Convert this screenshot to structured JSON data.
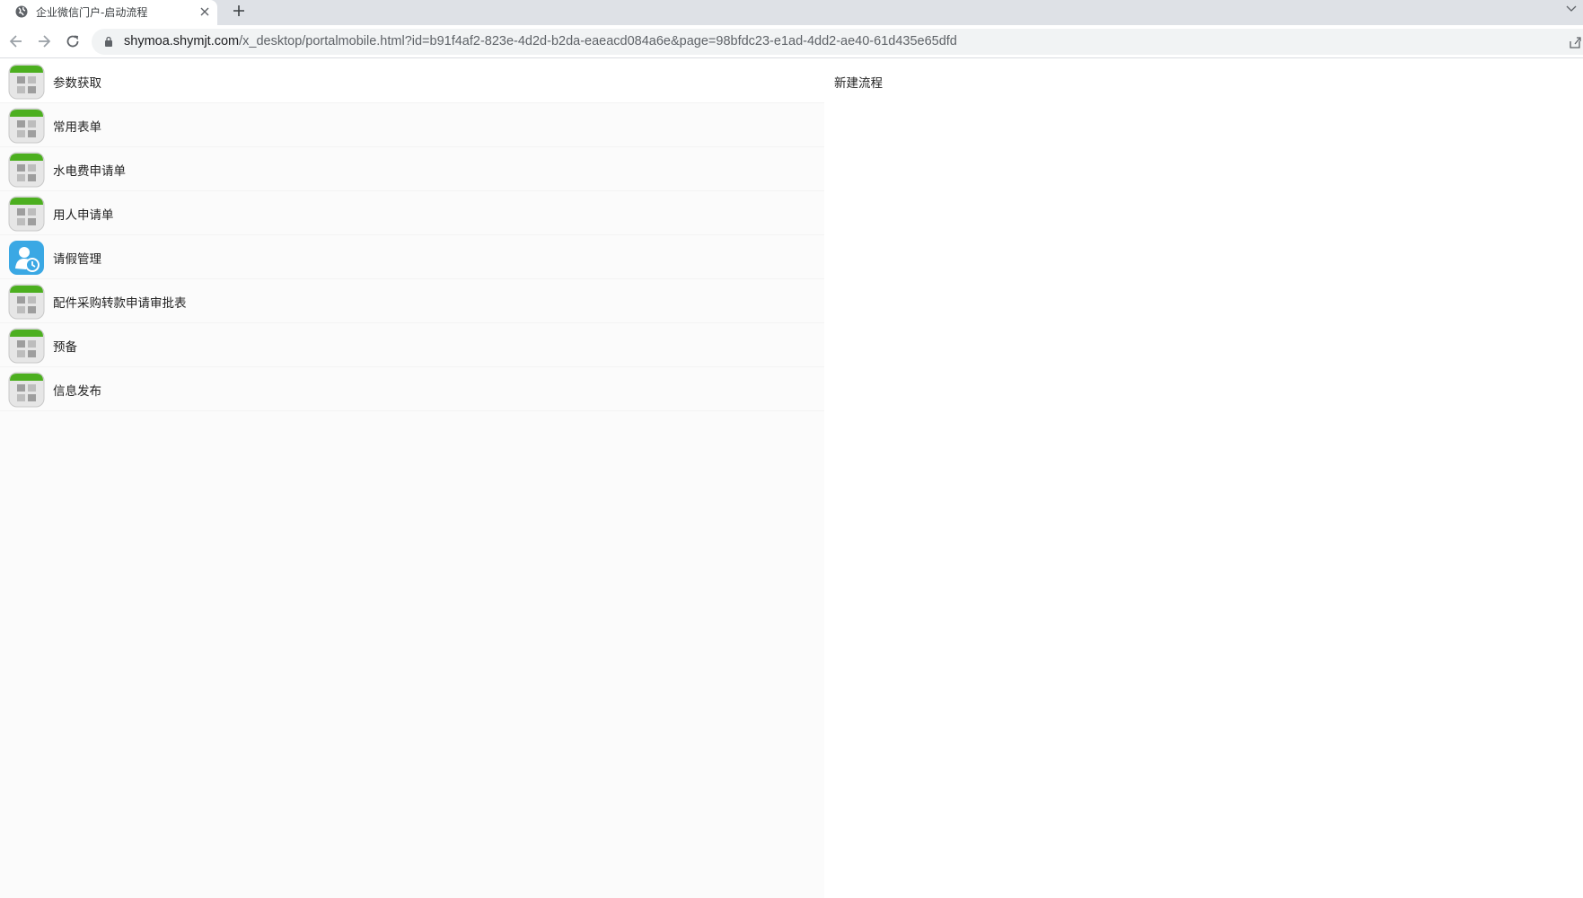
{
  "browser": {
    "tab_title": "企业微信门户-启动流程",
    "url_host": "shymoa.shymjt.com",
    "url_path": "/x_desktop/portalmobile.html?id=b91f4af2-823e-4d2d-b2da-eaeacd084a6e&page=98bfdc23-e1ad-4dd2-ae40-61d435e65dfd"
  },
  "list": {
    "items": [
      {
        "label": "参数获取",
        "icon": "app-grid-icon"
      },
      {
        "label": "常用表单",
        "icon": "app-grid-icon"
      },
      {
        "label": "水电费申请单",
        "icon": "app-grid-icon"
      },
      {
        "label": "用人申请单",
        "icon": "app-grid-icon"
      },
      {
        "label": "请假管理",
        "icon": "leave-clock-icon"
      },
      {
        "label": "配件采购转款申请审批表",
        "icon": "app-grid-icon"
      },
      {
        "label": "预备",
        "icon": "app-grid-icon"
      },
      {
        "label": "信息发布",
        "icon": "app-grid-icon"
      }
    ]
  },
  "right_panel": {
    "title": "新建流程"
  },
  "colors": {
    "icon_green": "#4caf1f",
    "icon_blue": "#3aa8e4",
    "panel_bg": "#fbfbfb"
  }
}
